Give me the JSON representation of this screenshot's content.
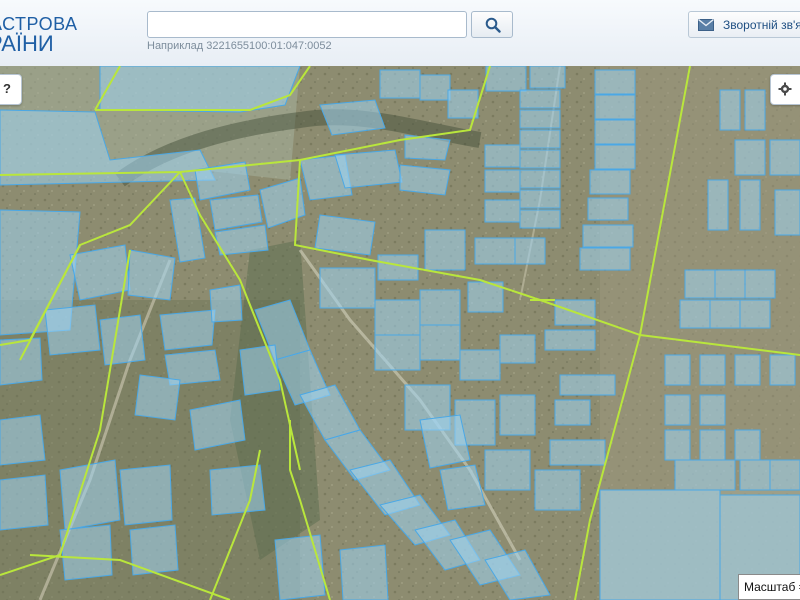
{
  "header": {
    "brand_line1": "АСТРОВА",
    "brand_line2": "РАЇНИ",
    "search": {
      "value": "",
      "placeholder": "",
      "button_icon": "search-icon"
    },
    "example_text": "Наприклад 3221655100:01:047:0052",
    "feedback": {
      "icon": "mail-icon",
      "label": "Зворотній зв'я"
    }
  },
  "map": {
    "left_control_label": "?",
    "right_control_icon": "gear-icon",
    "right_control_label": "",
    "scale_label": "Масштаб =",
    "colors": {
      "parcel_fill": "#9fd3f2",
      "parcel_stroke": "#4aa8e6",
      "boundary": "#b9e63c",
      "terrain": "#8a8a6e"
    }
  }
}
